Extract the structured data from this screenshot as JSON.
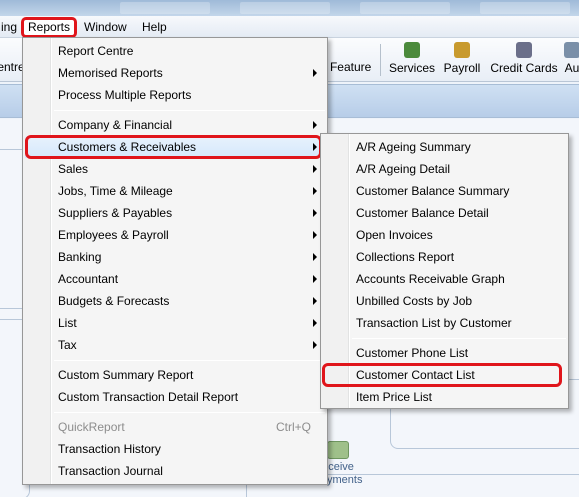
{
  "menubar": {
    "partial_left": "ing",
    "reports": "Reports",
    "window": "Window",
    "help": "Help"
  },
  "toolbar": {
    "partial_left": "entre",
    "feature": "v Feature",
    "services": "Services",
    "payroll": "Payroll",
    "credit_cards": "Credit Cards",
    "partial_right": "Au"
  },
  "workspace": {
    "receive_payments": [
      "eceive",
      "Payments"
    ]
  },
  "reports_menu": {
    "group1": [
      "Report Centre",
      "Memorised Reports",
      "Process Multiple Reports"
    ],
    "group2": [
      "Company & Financial",
      "Customers & Receivables",
      "Sales",
      "Jobs, Time & Mileage",
      "Suppliers & Payables",
      "Employees & Payroll",
      "Banking",
      "Accountant",
      "Budgets & Forecasts",
      "List",
      "Tax"
    ],
    "group3": [
      "Custom Summary Report",
      "Custom Transaction Detail Report"
    ],
    "group4": [
      "QuickReport",
      "Transaction History",
      "Transaction Journal"
    ],
    "quickreport_shortcut": "Ctrl+Q"
  },
  "customers_submenu": {
    "group1": [
      "A/R Ageing Summary",
      "A/R Ageing Detail",
      "Customer Balance Summary",
      "Customer Balance Detail",
      "Open Invoices",
      "Collections Report",
      "Accounts Receivable Graph",
      "Unbilled Costs by Job",
      "Transaction List by Customer"
    ],
    "group2": [
      "Customer Phone List",
      "Customer Contact List",
      "Item Price List"
    ]
  },
  "colors": {
    "highlight_red": "#e0151b",
    "menu_bg": "#f5f5f5"
  }
}
